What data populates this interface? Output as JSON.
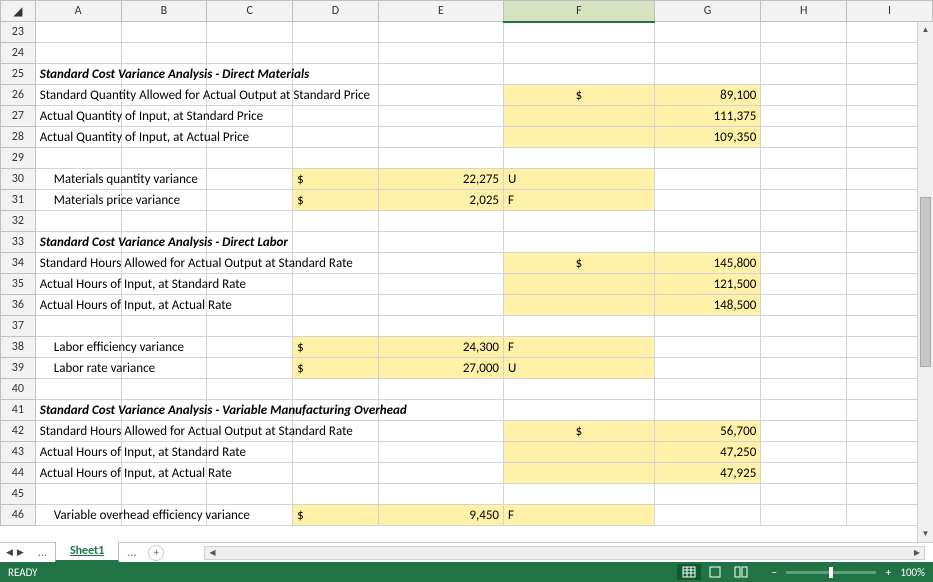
{
  "columns": [
    "A",
    "B",
    "C",
    "D",
    "E",
    "F",
    "G",
    "H",
    "I"
  ],
  "active_column": "F",
  "row_start": 23,
  "row_end": 46,
  "sections": {
    "s1": {
      "title": "Standard Cost Variance Analysis - Direct Materials",
      "lines": {
        "l1": {
          "label": "Standard Quantity Allowed for Actual Output at Standard Price",
          "cur": "$",
          "value": "89,100"
        },
        "l2": {
          "label": "Actual Quantity of Input, at Standard Price",
          "value": "111,375"
        },
        "l3": {
          "label": "Actual Quantity of Input, at Actual Price",
          "value": "109,350"
        }
      },
      "variances": {
        "v1": {
          "label": "Materials quantity variance",
          "cur": "$",
          "amount": "22,275",
          "flag": "U"
        },
        "v2": {
          "label": "Materials price variance",
          "cur": "$",
          "amount": "2,025",
          "flag": "F"
        }
      }
    },
    "s2": {
      "title": "Standard Cost Variance Analysis - Direct Labor",
      "lines": {
        "l1": {
          "label": "Standard Hours Allowed for Actual Output at Standard Rate",
          "cur": "$",
          "value": "145,800"
        },
        "l2": {
          "label": "Actual Hours of Input, at Standard Rate",
          "value": "121,500"
        },
        "l3": {
          "label": "Actual Hours of Input, at Actual Rate",
          "value": "148,500"
        }
      },
      "variances": {
        "v1": {
          "label": "Labor efficiency variance",
          "cur": "$",
          "amount": "24,300",
          "flag": "F"
        },
        "v2": {
          "label": "Labor rate variance",
          "cur": "$",
          "amount": "27,000",
          "flag": "U"
        }
      }
    },
    "s3": {
      "title": "Standard Cost Variance Analysis - Variable Manufacturing Overhead",
      "lines": {
        "l1": {
          "label": "Standard Hours Allowed for Actual Output at Standard Rate",
          "cur": "$",
          "value": "56,700"
        },
        "l2": {
          "label": "Actual Hours of Input, at Standard Rate",
          "value": "47,250"
        },
        "l3": {
          "label": "Actual Hours of Input, at Actual Rate",
          "value": "47,925"
        }
      },
      "variances": {
        "v1": {
          "label": "Variable overhead efficiency variance",
          "cur": "$",
          "amount": "9,450",
          "flag": "F"
        }
      }
    }
  },
  "sheet_tab": "Sheet1",
  "status": {
    "ready": "READY",
    "zoom": "100%"
  }
}
